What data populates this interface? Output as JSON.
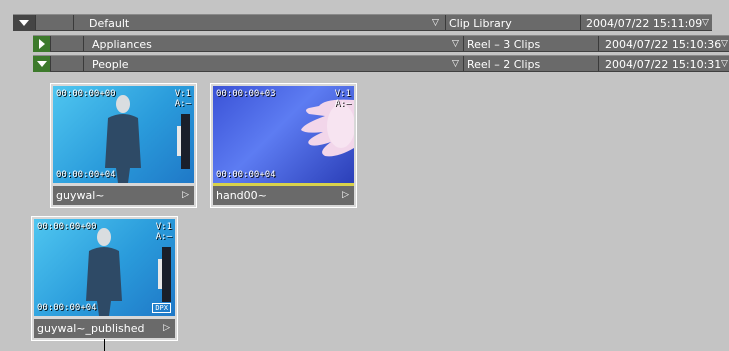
{
  "library": {
    "name": "Default",
    "type": "Clip Library",
    "date": "2004/07/22 15:11:09"
  },
  "reels": [
    {
      "name": "Appliances",
      "type": "Reel – 3 Clips",
      "date": "2004/07/22 15:10:36",
      "expanded": false
    },
    {
      "name": "People",
      "type": "Reel – 2 Clips",
      "date": "2004/07/22 15:10:31",
      "expanded": true
    }
  ],
  "clips": [
    {
      "name": "guywal~",
      "tc_in": "00:00:00+00",
      "tc_out": "00:00:00+04",
      "v": "V:1",
      "a": "A:–"
    },
    {
      "name": "hand00~",
      "tc_in": "00:00:00+03",
      "tc_out": "00:00:00+04",
      "v": "V:1",
      "a": "A:–"
    },
    {
      "name": "guywal~_published",
      "tc_in": "00:00:00+00",
      "tc_out": "00:00:00+04",
      "v": "V:1",
      "a": "A:–",
      "badge": "DPX"
    }
  ],
  "icons": {
    "expand": "triangle-down",
    "collapse": "triangle-right",
    "dropdown": "small-triangle-down",
    "play": "small-triangle-right"
  },
  "colors": {
    "background": "#c4c4c4",
    "row": "#6a6a6a",
    "expander_green": "#3d7a2c",
    "selection_bar": "#d9d24a"
  }
}
